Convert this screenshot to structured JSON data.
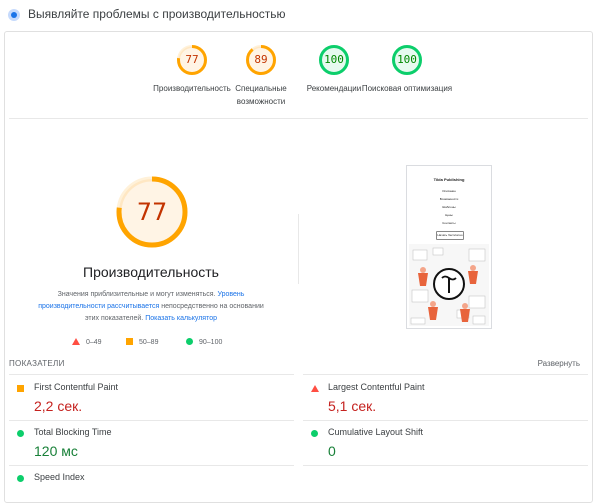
{
  "header": {
    "title": "Выявляйте проблемы с производительностью"
  },
  "gauges": [
    {
      "score": "77",
      "label": "Производительность",
      "color": "#ffa400",
      "text_color": "#c33300",
      "value": 77
    },
    {
      "score": "89",
      "label": "Специальные возможности",
      "color": "#ffa400",
      "text_color": "#c33300",
      "value": 89
    },
    {
      "score": "100",
      "label": "Рекомендации",
      "color": "#0cce6b",
      "text_color": "#008800",
      "value": 100
    },
    {
      "score": "100",
      "label": "Поисковая оптимизация",
      "color": "#0cce6b",
      "text_color": "#008800",
      "value": 100
    }
  ],
  "performance": {
    "score": "77",
    "value": 77,
    "title": "Производительность",
    "desc_prefix": "Значения приблизительные и могут изменяться.",
    "desc_link1": "Уровень производительности рассчитывается",
    "desc_middle": "непосредственно на основании этих показателей.",
    "desc_link2": "Показать калькулятор"
  },
  "legend": [
    {
      "icon": "triangle-red",
      "label": "0–49"
    },
    {
      "icon": "square-orange",
      "label": "50–89"
    },
    {
      "icon": "circle-green",
      "label": "90–100"
    }
  ],
  "screenshot": {
    "site_title": "Tilda Publishing",
    "lines": [
      "Описание",
      "Возможности",
      "Шаблоны",
      "Цены",
      "Контакты"
    ],
    "button": "Начать бесплатно"
  },
  "metrics": {
    "header": "ПОКАЗАТЕЛИ",
    "expand": "Развернуть",
    "items": [
      {
        "name": "First Contentful Paint",
        "value": "2,2 сек.",
        "status": "average"
      },
      {
        "name": "Largest Contentful Paint",
        "value": "5,1 сек.",
        "status": "fail"
      },
      {
        "name": "Total Blocking Time",
        "value": "120 мс",
        "status": "pass"
      },
      {
        "name": "Cumulative Layout Shift",
        "value": "0",
        "status": "pass"
      },
      {
        "name": "Speed Index",
        "value": "",
        "status": "pass"
      }
    ]
  },
  "colors": {
    "average": "#ffa400",
    "fail": "#ff4e42",
    "pass": "#0cce6b",
    "link": "#1a73e8"
  }
}
